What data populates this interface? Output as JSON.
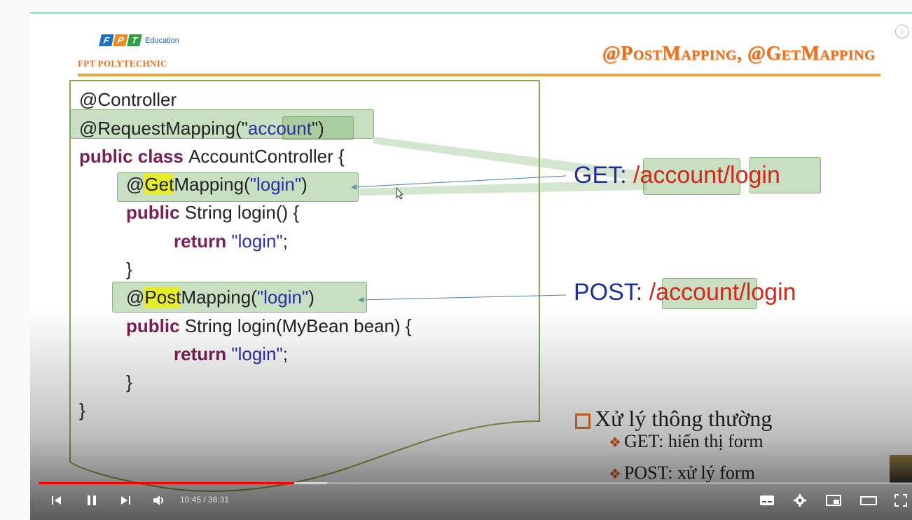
{
  "logo": {
    "brand": "FPT",
    "education": "Education",
    "school": "FPT POLYTECHNIC"
  },
  "slide": {
    "title": "@PostMapping, @GetMapping",
    "code": {
      "line1": "@Controller",
      "line2_a": "@RequestMapping(\"",
      "line2_b": "account",
      "line2_c": "\")",
      "line3_kw": "public class ",
      "line3_name": "AccountController",
      "line3_end": " {",
      "line4_a": "@",
      "line4_b": "Get",
      "line4_c": "Mapping(",
      "line4_d": "\"login\"",
      "line4_e": ")",
      "line5_kw": "public",
      "line5_rest": " String login() {",
      "line6_kw": "return",
      "line6_str": " \"login\"",
      "line6_end": ";",
      "line7": "}",
      "line8_a": "@",
      "line8_b": "Post",
      "line8_c": "Mapping(",
      "line8_d": "\"login\"",
      "line8_e": ")",
      "line9_kw": "public",
      "line9_rest": " String login(MyBean bean) {",
      "line10_kw": "return",
      "line10_str": " \"login\"",
      "line10_end": ";",
      "line11": "}",
      "line12": "}"
    },
    "get_label": "GET: ",
    "get_path_a": "/",
    "get_path_b": "account",
    "get_path_c": "/",
    "get_path_d": "login",
    "post_label": "POST: ",
    "post_path_a": "/",
    "post_path_b": "account",
    "post_path_c": "/login",
    "bullet_main": "Xử lý thông thường",
    "bullet_get": "GET: hiển thị form",
    "bullet_post": "POST: xử lý form"
  },
  "player": {
    "time": "10:45 / 36:31",
    "progress_played": 0.293,
    "progress_buffered": 0.33,
    "icons": [
      "previous-icon",
      "pause-icon",
      "next-icon",
      "volume-icon",
      "subtitles-icon",
      "settings-icon",
      "miniplayer-icon",
      "theater-icon",
      "fullscreen-icon"
    ]
  },
  "colors": {
    "accent": "#e8701e",
    "code_keyword": "#7a1f54",
    "code_string": "#2a2fa8",
    "progress": "#ff0000"
  }
}
